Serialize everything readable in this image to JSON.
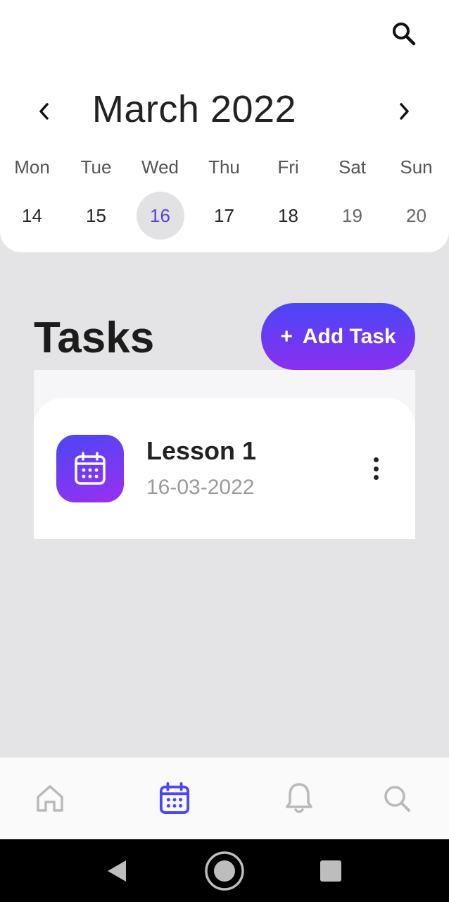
{
  "calendar": {
    "month_title": "March 2022",
    "prev_icon": "chevron-left-icon",
    "next_icon": "chevron-right-icon",
    "weekdays": [
      "Mon",
      "Tue",
      "Wed",
      "Thu",
      "Fri",
      "Sat",
      "Sun"
    ],
    "dates": [
      "14",
      "15",
      "16",
      "17",
      "18",
      "19",
      "20"
    ],
    "selected_date": "16"
  },
  "header": {
    "search_icon": "search-icon"
  },
  "tasks": {
    "title": "Tasks",
    "add_button_plus": "+",
    "add_button_label": "Add Task",
    "items": [
      {
        "title": "Lesson 1",
        "date": "16-03-2022",
        "icon": "calendar-icon",
        "menu_icon": "more-vertical-icon"
      }
    ]
  },
  "bottom_nav": {
    "items": [
      {
        "icon": "home-icon",
        "active": false
      },
      {
        "icon": "calendar-icon",
        "active": true
      },
      {
        "icon": "bell-icon",
        "active": false
      },
      {
        "icon": "search-icon",
        "active": false
      }
    ]
  },
  "colors": {
    "accent_start": "#4a47f5",
    "accent_end": "#8a2ff0",
    "selected_date_text": "#5a3fd6",
    "nav_active": "#4a47f5",
    "nav_inactive": "#b9b9b9"
  }
}
